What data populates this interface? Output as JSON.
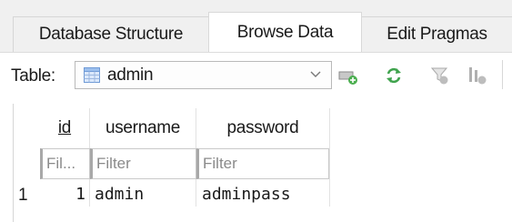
{
  "tabs": [
    {
      "label": "Database Structure",
      "active": false
    },
    {
      "label": "Browse Data",
      "active": true
    },
    {
      "label": "Edit Pragmas",
      "active": false
    }
  ],
  "toolbar": {
    "table_label": "Table:",
    "selected_table": "admin",
    "icons": [
      "table-icon",
      "chevron-down-icon",
      "new-record-icon",
      "refresh-icon",
      "clear-filters-icon",
      "clear-sort-icon"
    ]
  },
  "grid": {
    "columns": [
      {
        "header": "id",
        "filter_placeholder": "Fil..."
      },
      {
        "header": "username",
        "filter_placeholder": "Filter"
      },
      {
        "header": "password",
        "filter_placeholder": "Filter"
      }
    ],
    "rows": [
      {
        "row_number": "1",
        "id": "1",
        "username": "admin",
        "password": "adminpass"
      }
    ]
  },
  "colors": {
    "tab_bg": "#f0f0f0",
    "active_tab_bg": "#ffffff",
    "border": "#d6d6d6",
    "icon_green": "#3fa34d",
    "icon_gray": "#a9a9a9"
  }
}
